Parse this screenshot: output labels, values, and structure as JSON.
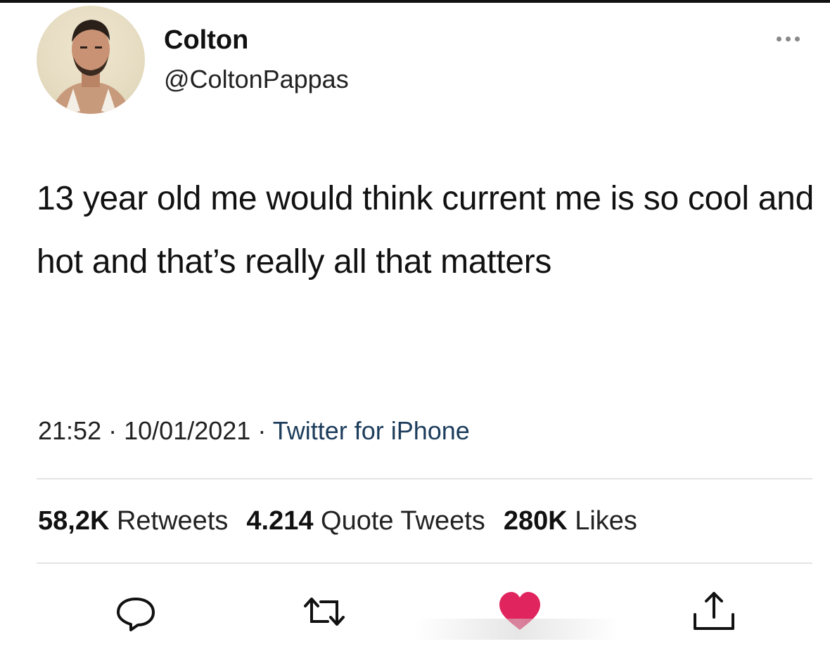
{
  "user": {
    "name": "Colton",
    "handle": "@ColtonPappas"
  },
  "tweet": {
    "text": "13 year old me would think current me is so cool and hot and that’s really all that matters"
  },
  "meta": {
    "time": "21:52",
    "date": "10/01/2021",
    "separator": "·",
    "source": "Twitter for iPhone"
  },
  "stats": {
    "retweets_count": "58,2K",
    "retweets_label": "Retweets",
    "quotes_count": "4.214",
    "quotes_label": "Quote Tweets",
    "likes_count": "280K",
    "likes_label": "Likes"
  },
  "icons": {
    "more": "more-icon",
    "reply": "reply-icon",
    "retweet": "retweet-icon",
    "like": "heart-icon",
    "share": "share-icon"
  },
  "colors": {
    "like_active": "#e0245e",
    "source_link": "#1d3d5c"
  }
}
